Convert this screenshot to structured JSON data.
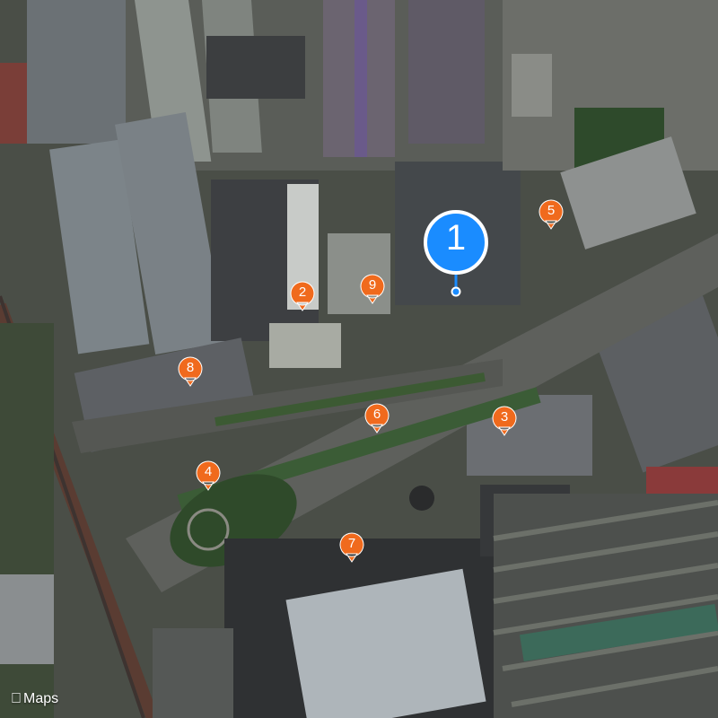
{
  "map": {
    "provider_label": "Maps",
    "provider_icon": "apple-logo-icon",
    "view": "satellite"
  },
  "primary_marker": {
    "label": "1",
    "color": "#1a8cff"
  },
  "markers": [
    {
      "label": "2",
      "color": "#f06a1d"
    },
    {
      "label": "3",
      "color": "#f06a1d"
    },
    {
      "label": "4",
      "color": "#f06a1d"
    },
    {
      "label": "5",
      "color": "#f06a1d"
    },
    {
      "label": "6",
      "color": "#f06a1d"
    },
    {
      "label": "7",
      "color": "#f06a1d"
    },
    {
      "label": "8",
      "color": "#f06a1d"
    },
    {
      "label": "9",
      "color": "#f06a1d"
    }
  ]
}
